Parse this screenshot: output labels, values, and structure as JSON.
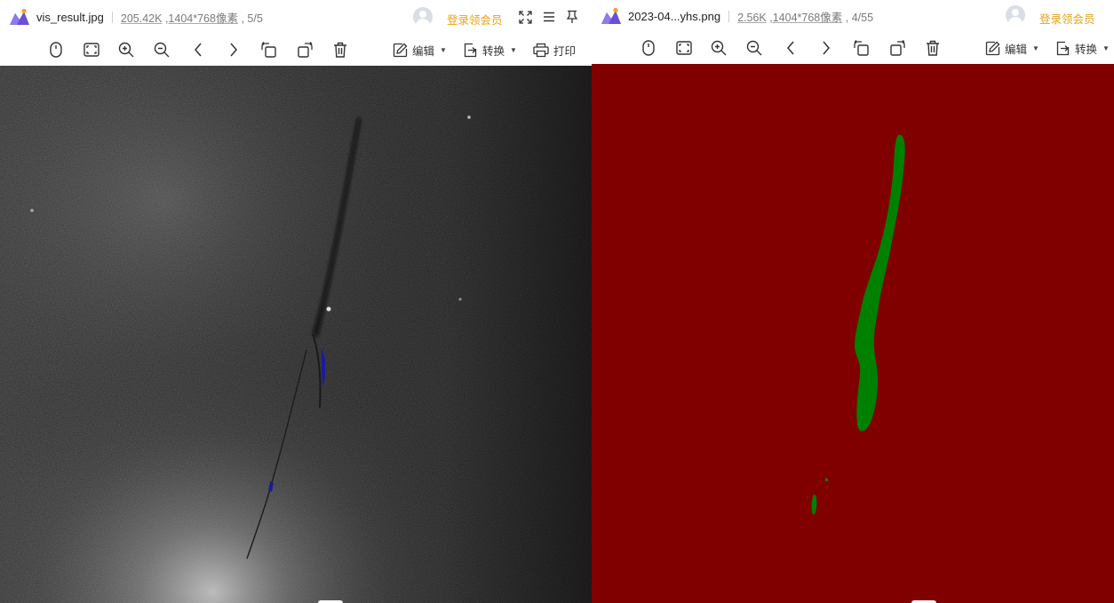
{
  "left_viewer": {
    "filename": "vis_result.jpg",
    "file_size": "205.42K",
    "dimensions": ",1404*768像素",
    "index": "5/5",
    "vip_label": "登录领会员",
    "toolbar": {
      "edit_label": "编辑",
      "convert_label": "转换",
      "print_label": "打印"
    }
  },
  "right_viewer": {
    "filename": "2023-04...yhs.png",
    "file_size": "2.56K",
    "dimensions": ",1404*768像素",
    "index": "4/55",
    "vip_label": "登录领会员",
    "toolbar": {
      "edit_label": "编辑",
      "convert_label": "转换"
    }
  },
  "colors": {
    "accent_vip": "#e8a317",
    "mask_background": "#800000",
    "mask_defect": "#008000",
    "overlay_defect": "#1a1aa0"
  },
  "icons": [
    "mouse-icon",
    "fit-screen-icon",
    "zoom-in-icon",
    "zoom-out-icon",
    "previous-icon",
    "next-icon",
    "rotate-left-icon",
    "rotate-right-icon",
    "delete-icon",
    "edit-icon",
    "convert-icon",
    "print-icon",
    "fullscreen-icon",
    "menu-icon",
    "pin-icon",
    "user-avatar-icon"
  ]
}
